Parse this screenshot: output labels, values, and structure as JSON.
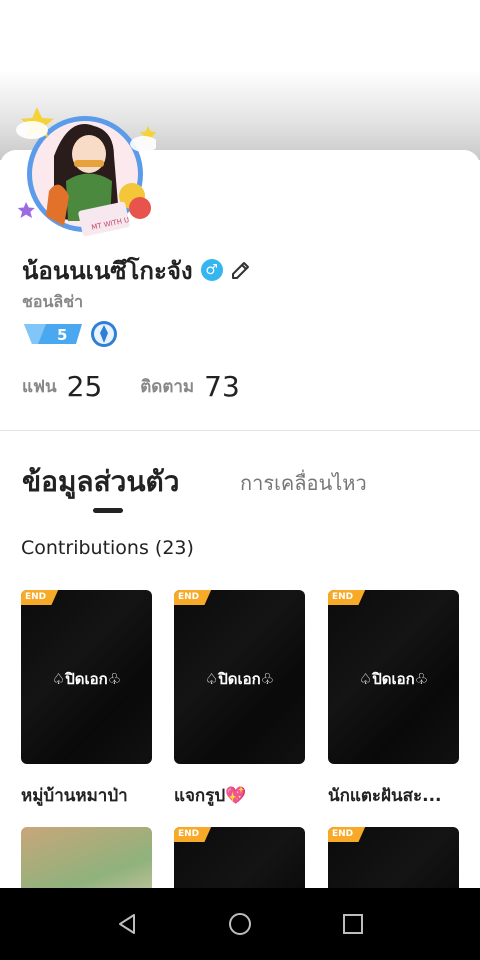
{
  "profile": {
    "name": "น้อนนเนซึโกะจัง",
    "subname": "ชอนลิช่า",
    "gender_symbol": "♂",
    "level": "5",
    "avatar_caption": "MT WITH U",
    "stats": [
      {
        "label": "แฟน",
        "value": "25"
      },
      {
        "label": "ติดตาม",
        "value": "73"
      }
    ]
  },
  "tabs": {
    "active": "ข้อมูลส่วนตัว",
    "inactive": "การเคลื่อนไหว"
  },
  "contributions": {
    "title": "Contributions (23)",
    "items": [
      {
        "title": "หมู่บ้านหมาป่า",
        "badge": "END",
        "cover_text": "♤ปิดเอก♧"
      },
      {
        "title": "แจกรูป💖",
        "badge": "END",
        "cover_text": "♤ปิดเอก♧"
      },
      {
        "title": "นักแตะฝันสะ...",
        "badge": "END",
        "cover_text": "♤ปิดเอก♧"
      },
      {
        "title": "",
        "badge": "",
        "cover_text": ""
      },
      {
        "title": "",
        "badge": "END",
        "cover_text": ""
      },
      {
        "title": "",
        "badge": "END",
        "cover_text": ""
      }
    ]
  },
  "navbar": {
    "icons": [
      "back-icon",
      "home-icon",
      "recents-icon"
    ]
  },
  "colors": {
    "badge": "#f7a928",
    "gender": "#35b6f0",
    "level": "#4aa8f0",
    "avatar_ring": "#5b9bea"
  }
}
